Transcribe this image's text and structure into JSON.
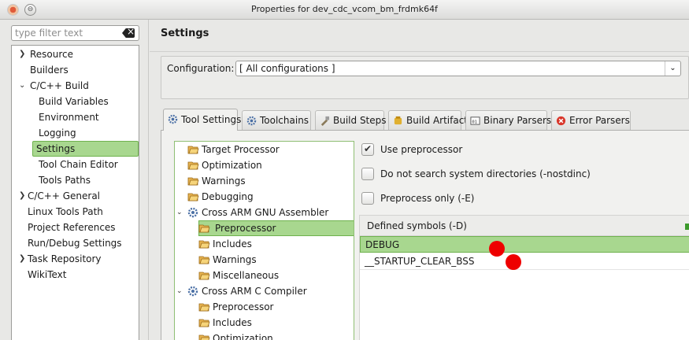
{
  "window": {
    "title": "Properties for dev_cdc_vcom_bm_frdmk64f"
  },
  "filter": {
    "placeholder": "type filter text"
  },
  "nav": {
    "items": [
      {
        "label": "Resource",
        "expandable": true
      },
      {
        "label": "Builders",
        "expandable": false
      },
      {
        "label": "C/C++ Build",
        "expandable": true,
        "expanded": true
      },
      {
        "label": "Build Variables",
        "child": true
      },
      {
        "label": "Environment",
        "child": true
      },
      {
        "label": "Logging",
        "child": true
      },
      {
        "label": "Settings",
        "child": true,
        "selected": true
      },
      {
        "label": "Tool Chain Editor",
        "child": true
      },
      {
        "label": "Tools Paths",
        "child": true
      },
      {
        "label": "C/C++ General",
        "expandable": true
      },
      {
        "label": "Linux Tools Path",
        "expandable": false
      },
      {
        "label": "Project References",
        "expandable": false
      },
      {
        "label": "Run/Debug Settings",
        "expandable": false
      },
      {
        "label": "Task Repository",
        "expandable": true
      },
      {
        "label": "WikiText",
        "expandable": false
      }
    ]
  },
  "page": {
    "title": "Settings"
  },
  "config": {
    "label": "Configuration:",
    "value": "[ All configurations ]"
  },
  "tabs": [
    {
      "label": "Tool Settings",
      "icon": "tool-settings-icon",
      "active": true
    },
    {
      "label": "Toolchains",
      "icon": "toolchains-icon"
    },
    {
      "label": "Build Steps",
      "icon": "build-steps-icon"
    },
    {
      "label": "Build Artifact",
      "icon": "build-artifact-icon"
    },
    {
      "label": "Binary Parsers",
      "icon": "binary-parsers-icon"
    },
    {
      "label": "Error Parsers",
      "icon": "error-parsers-icon"
    }
  ],
  "tooltree": {
    "items": [
      {
        "label": "Target Processor",
        "type": "folder"
      },
      {
        "label": "Optimization",
        "type": "folder"
      },
      {
        "label": "Warnings",
        "type": "folder"
      },
      {
        "label": "Debugging",
        "type": "folder"
      },
      {
        "label": "Cross ARM GNU Assembler",
        "type": "tool",
        "expanded": true
      },
      {
        "label": "Preprocessor",
        "type": "folder",
        "selected": true
      },
      {
        "label": "Includes",
        "type": "folder"
      },
      {
        "label": "Warnings",
        "type": "folder"
      },
      {
        "label": "Miscellaneous",
        "type": "folder"
      },
      {
        "label": "Cross ARM C Compiler",
        "type": "tool",
        "expanded": true
      },
      {
        "label": "Preprocessor",
        "type": "folder"
      },
      {
        "label": "Includes",
        "type": "folder"
      },
      {
        "label": "Optimization",
        "type": "folder"
      }
    ]
  },
  "options": {
    "use_preprocessor": {
      "label": "Use preprocessor",
      "checked": true
    },
    "nostdinc": {
      "label": "Do not search system directories (-nostdinc)",
      "checked": false
    },
    "preprocess_only": {
      "label": "Preprocess only (-E)",
      "checked": false
    }
  },
  "symbols": {
    "header": "Defined symbols (-D)",
    "items": [
      "DEBUG",
      "__STARTUP_CLEAR_BSS"
    ]
  },
  "colors": {
    "selection": "#a8d78f",
    "selection_border": "#6fb24e",
    "marker": "#ee0000"
  }
}
